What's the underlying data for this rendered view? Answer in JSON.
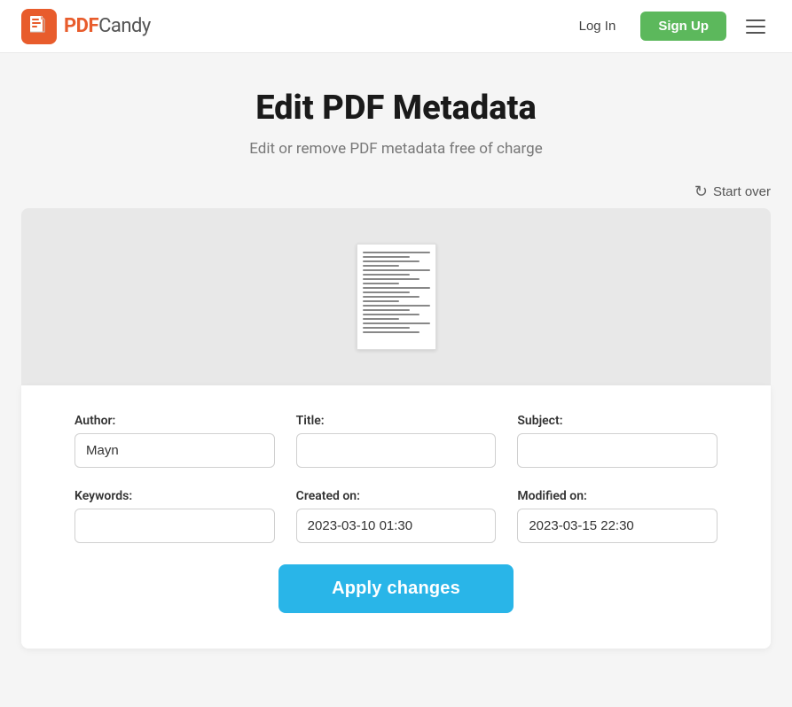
{
  "navbar": {
    "logo_pdf": "PDF",
    "logo_candy": "Candy",
    "login_label": "Log In",
    "signup_label": "Sign Up"
  },
  "header": {
    "title": "Edit PDF Metadata",
    "subtitle": "Edit or remove PDF metadata free of charge",
    "start_over_label": "Start over"
  },
  "form": {
    "author_label": "Author:",
    "author_value": "Mayn",
    "author_placeholder": "",
    "title_label": "Title:",
    "title_value": "",
    "title_placeholder": "",
    "subject_label": "Subject:",
    "subject_value": "",
    "subject_placeholder": "",
    "keywords_label": "Keywords:",
    "keywords_value": "",
    "keywords_placeholder": "",
    "created_on_label": "Created on:",
    "created_on_value": "2023-03-10 01:30",
    "modified_on_label": "Modified on:",
    "modified_on_value": "2023-03-15 22:30",
    "apply_button_label": "Apply changes"
  }
}
